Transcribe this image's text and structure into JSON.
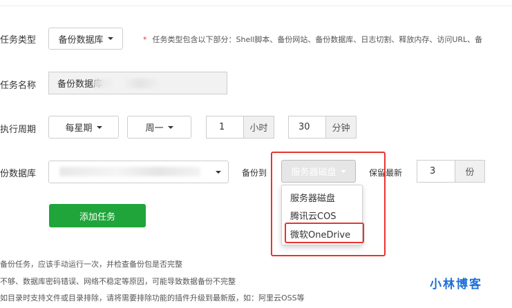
{
  "form": {
    "task_type": {
      "label": "任务类型",
      "value": "备份数据库",
      "note_star": "*",
      "note": "任务类型包含以下部分：Shell脚本、备份网站、备份数据库、日志切割、释放内存、访问URL、备"
    },
    "task_name": {
      "label": "任务名称",
      "value": "备份数据库"
    },
    "period": {
      "label": "执行周期",
      "frequency": "每星期",
      "weekday": "周一",
      "hour_value": "1",
      "hour_unit": "小时",
      "minute_value": "30",
      "minute_unit": "分钟"
    },
    "backup_db": {
      "label": "份数据库",
      "backup_to_label": "备份到",
      "target_selected": "服务器磁盘",
      "keep_latest_label": "保留最新",
      "keep_value": "3",
      "keep_unit": "份"
    },
    "target_options": [
      "服务器磁盘",
      "腾讯云COS",
      "微软OneDrive"
    ],
    "add_button": "添加任务"
  },
  "footnotes": [
    "备份任务，应该手动运行一次，并检查备份包是否完整",
    "不够、数据库密码错误、网络不稳定等原因，可能导致数据备份不完整",
    "如目录时支持文件或目录排除，请将需要排除功能的插件升级到最新版，如：阿里云OSS等"
  ],
  "watermark": "小林博客",
  "colors": {
    "accent_green": "#20a53a",
    "highlight_red": "#e8332e",
    "required_star": "#e33333"
  }
}
